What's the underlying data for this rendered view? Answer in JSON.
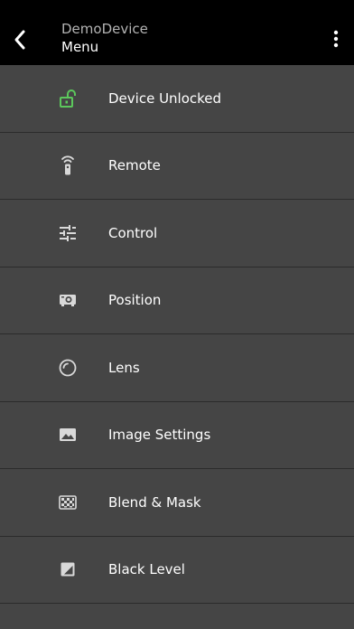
{
  "header": {
    "title": "DemoDevice",
    "subtitle": "Menu",
    "back_icon": "chevron-left-icon",
    "more_icon": "more-vertical-icon"
  },
  "colors": {
    "unlocked_accent": "#5cc85c",
    "icon": "#d9d9d9",
    "background": "#454545",
    "appbar": "#000000"
  },
  "menu": {
    "items": [
      {
        "label": "Device Unlocked",
        "icon": "unlocked-icon"
      },
      {
        "label": "Remote",
        "icon": "remote-icon"
      },
      {
        "label": "Control",
        "icon": "tune-icon"
      },
      {
        "label": "Position",
        "icon": "projector-icon"
      },
      {
        "label": "Lens",
        "icon": "lens-icon"
      },
      {
        "label": "Image Settings",
        "icon": "image-icon"
      },
      {
        "label": "Blend & Mask",
        "icon": "checkerboard-icon"
      },
      {
        "label": "Black Level",
        "icon": "contrast-icon"
      }
    ]
  }
}
